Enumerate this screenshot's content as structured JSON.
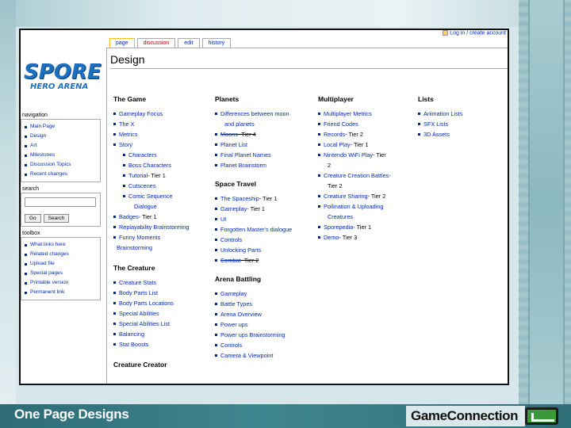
{
  "footer": {
    "title": "One Page Designs",
    "brand_bold": "Game",
    "brand_rest": "Connection"
  },
  "wiki": {
    "logo_main": "SPORE",
    "logo_sub": "HERO ARENA",
    "usertools": "Log in / create account",
    "tabs": [
      "page",
      "discussion",
      "edit",
      "history"
    ],
    "page_title": "Design",
    "sidebar": {
      "navigation_heading": "navigation",
      "navigation": [
        "Main Page",
        "Design",
        "Art",
        "Milestones",
        "Discussion Topics",
        "Recent changes"
      ],
      "search_heading": "search",
      "go_label": "Go",
      "search_label": "Search",
      "toolbox_heading": "toolbox",
      "toolbox": [
        "What links here",
        "Related changes",
        "Upload file",
        "Special pages",
        "Printable version",
        "Permanent link"
      ]
    },
    "game": {
      "heading": "The Game",
      "items": [
        "Gameplay Focus",
        "The X",
        "Metrics",
        "Story"
      ],
      "story_sub": [
        "Characters",
        "Boss Characters",
        "Tutorial",
        "Cutscenes",
        "Comic Sequence"
      ],
      "tutorial_tier": " - Tier 1",
      "comic_cont": "Dialogue",
      "items2": [
        "Badges",
        "Replayability Brainstorming",
        "Funny Moments"
      ],
      "badges_tier": " - Tier 1",
      "funny_cont": "Brainstorming"
    },
    "creature": {
      "heading": "The Creature",
      "items": [
        "Creature Stats",
        "Body Parts List",
        "Body Parts Locations",
        "Special Abilities",
        "Special Abilities List",
        "Balancing",
        "Stat Boosts"
      ]
    },
    "creator": {
      "heading": "Creature Creator"
    },
    "planets": {
      "heading": "Planets",
      "items": [
        "Differences between moon",
        "Moons",
        "Planet List",
        "Final Planet Names",
        "Planet Brainstorm"
      ],
      "diff_cont": "and planets",
      "moons_tier": " - Tier 4"
    },
    "space": {
      "heading": "Space Travel",
      "items": [
        "The Spaceship",
        "Gameplay",
        "UI",
        "Forgotten Master's dialogue",
        "Controls",
        "Unlocking Parts",
        "Combat"
      ],
      "spaceship_tier": " - Tier 1",
      "gameplay_tier": " - Tier 1",
      "combat_tier": " - Tier 2"
    },
    "arena": {
      "heading": "Arena Battling",
      "items": [
        "Gameplay",
        "Battle Types",
        "Arena Overview",
        "Power ups",
        "Power ups Brainstorming",
        "Controls",
        "Camera & Viewpoint"
      ]
    },
    "multiplayer": {
      "heading": "Multiplayer",
      "items": [
        "Multiplayer Metrics",
        "Friend Codes",
        "Records",
        "Local Play",
        "Nintendo WiFi Play",
        "Creature Creation Battles",
        "Creature Sharing",
        "Pollination & Uploading",
        "Sporepedia",
        "Demo"
      ],
      "records_tier": " - Tier 2",
      "local_tier": " - Tier 1",
      "wifi_tier": " - Tier",
      "wifi_cont": "2",
      "ccb_tier": " -",
      "ccb_cont": "Tier 2",
      "sharing_tier": " - Tier 2",
      "pollination_cont": "Creatures",
      "sporepedia_tier": " - Tier 1",
      "demo_tier": " - Tier 3"
    },
    "lists": {
      "heading": "Lists",
      "items": [
        "Animation Lists",
        "SFX Lists",
        "3D Assets"
      ]
    }
  }
}
